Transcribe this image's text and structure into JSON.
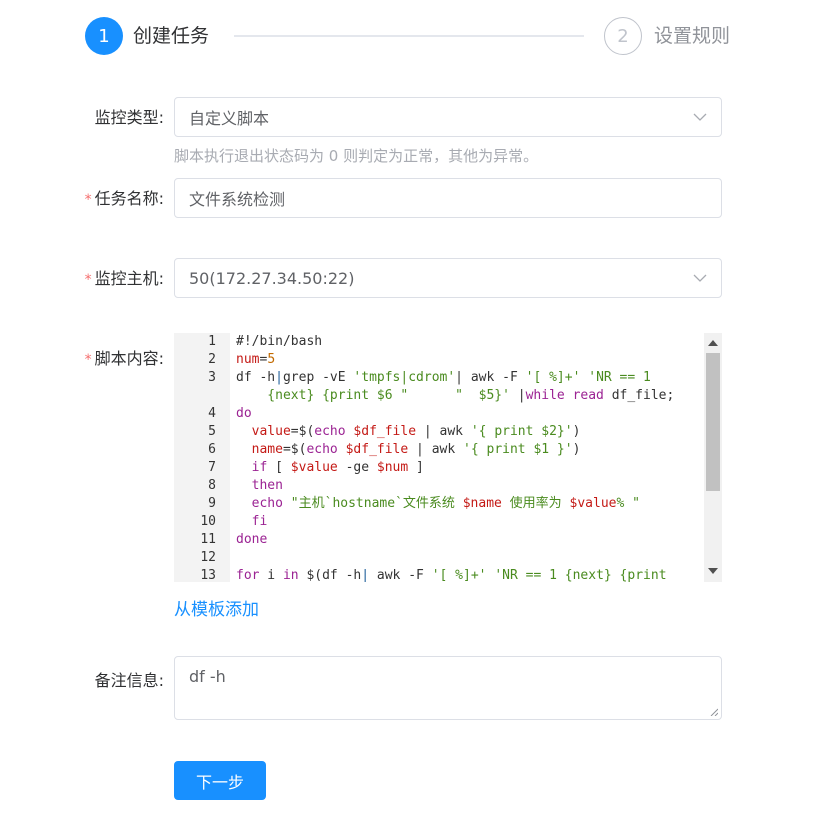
{
  "steps": [
    {
      "number": "1",
      "title": "创建任务"
    },
    {
      "number": "2",
      "title": "设置规则"
    }
  ],
  "form": {
    "monitor_type": {
      "label": "监控类型:",
      "value": "自定义脚本",
      "hint": "脚本执行退出状态码为 0 则判定为正常，其他为异常。"
    },
    "task_name": {
      "required_mark": "*",
      "label": "任务名称:",
      "value": "文件系统检测"
    },
    "monitor_host": {
      "required_mark": "*",
      "label": "监控主机:",
      "value": "50(172.27.34.50:22)"
    },
    "script": {
      "required_mark": "*",
      "label": "脚本内容:"
    },
    "template_link": "从模板添加",
    "remark": {
      "label": "备注信息:",
      "value": "df -h"
    },
    "next_button": "下一步"
  },
  "editor": {
    "line_numbers": [
      "1",
      "2",
      "3",
      "",
      "4",
      "5",
      "6",
      "7",
      "8",
      "9",
      "10",
      "11",
      "12",
      "13"
    ],
    "lines": [
      [
        {
          "t": "#!/bin/bash"
        }
      ],
      [
        {
          "t": "num",
          "c": "v"
        },
        {
          "t": "="
        },
        {
          "t": "5",
          "c": "n"
        }
      ],
      [
        {
          "t": "df -h"
        },
        {
          "t": "|",
          "c": "sc"
        },
        {
          "t": "grep -vE "
        },
        {
          "t": "'tmpfs|cdrom'",
          "c": "s"
        },
        {
          "t": "| awk -F "
        },
        {
          "t": "'[ %]+'",
          "c": "s"
        },
        {
          "t": " "
        },
        {
          "t": "'NR == 1",
          "c": "s"
        }
      ],
      [
        {
          "t": "    {next} {print $6 \"      \"  $5}'",
          "c": "s"
        },
        {
          "t": " |"
        },
        {
          "t": "while",
          "c": "k"
        },
        {
          "t": " "
        },
        {
          "t": "read",
          "c": "k"
        },
        {
          "t": " df_file;"
        }
      ],
      [
        {
          "t": "do",
          "c": "k"
        }
      ],
      [
        {
          "t": "  "
        },
        {
          "t": "value",
          "c": "v"
        },
        {
          "t": "=$("
        },
        {
          "t": "echo",
          "c": "k"
        },
        {
          "t": " "
        },
        {
          "t": "$df_file",
          "c": "v"
        },
        {
          "t": " | awk "
        },
        {
          "t": "'{ print $2}'",
          "c": "s"
        },
        {
          "t": ")"
        }
      ],
      [
        {
          "t": "  "
        },
        {
          "t": "name",
          "c": "v"
        },
        {
          "t": "=$("
        },
        {
          "t": "echo",
          "c": "k"
        },
        {
          "t": " "
        },
        {
          "t": "$df_file",
          "c": "v"
        },
        {
          "t": " | awk "
        },
        {
          "t": "'{ print $1 }'",
          "c": "s"
        },
        {
          "t": ")"
        }
      ],
      [
        {
          "t": "  "
        },
        {
          "t": "if",
          "c": "k"
        },
        {
          "t": " [ "
        },
        {
          "t": "$value",
          "c": "v"
        },
        {
          "t": " -ge "
        },
        {
          "t": "$num",
          "c": "v"
        },
        {
          "t": " ]"
        }
      ],
      [
        {
          "t": "  "
        },
        {
          "t": "then",
          "c": "k"
        }
      ],
      [
        {
          "t": "  "
        },
        {
          "t": "echo",
          "c": "k"
        },
        {
          "t": " "
        },
        {
          "t": "\"主机`hostname`文件系统 ",
          "c": "s"
        },
        {
          "t": "$name",
          "c": "v"
        },
        {
          "t": " 使用率为 ",
          "c": "s"
        },
        {
          "t": "$value",
          "c": "v"
        },
        {
          "t": "% \"",
          "c": "s"
        }
      ],
      [
        {
          "t": "  "
        },
        {
          "t": "fi",
          "c": "k"
        }
      ],
      [
        {
          "t": "done",
          "c": "k"
        }
      ],
      [
        {
          "t": ""
        }
      ],
      [
        {
          "t": "for",
          "c": "k"
        },
        {
          "t": " i "
        },
        {
          "t": "in",
          "c": "k"
        },
        {
          "t": " $(df -h"
        },
        {
          "t": "|",
          "c": "sc"
        },
        {
          "t": " awk -F "
        },
        {
          "t": "'[ %]+'",
          "c": "s"
        },
        {
          "t": " "
        },
        {
          "t": "'NR == 1 {next} {print",
          "c": "s"
        }
      ]
    ]
  }
}
